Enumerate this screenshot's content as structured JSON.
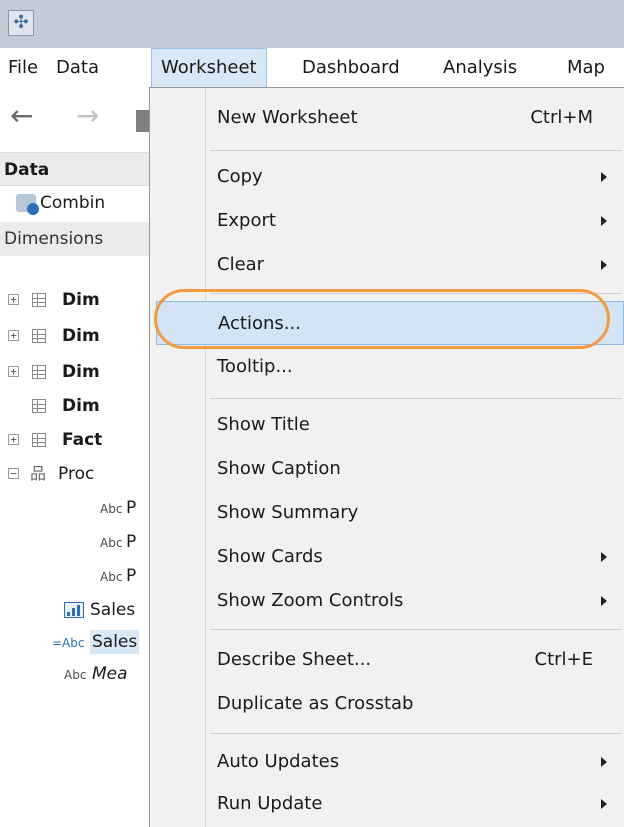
{
  "menubar": {
    "items": [
      "File",
      "Data",
      "Worksheet",
      "Dashboard",
      "Analysis",
      "Map"
    ]
  },
  "sidebar": {
    "data_header": "Data",
    "datasource": "Combin",
    "dimensions_header": "Dimensions",
    "tree": [
      {
        "label": "Dim",
        "type": "table",
        "expandable": true,
        "bold": true
      },
      {
        "label": "Dim",
        "type": "table",
        "expandable": true,
        "bold": true
      },
      {
        "label": "Dim",
        "type": "table",
        "expandable": true,
        "bold": true
      },
      {
        "label": "Dim",
        "type": "table",
        "expandable": false,
        "bold": true
      },
      {
        "label": "Fact",
        "type": "table",
        "expandable": true,
        "bold": true
      },
      {
        "label": "Proc",
        "type": "hierarchy",
        "expandable": true,
        "expanded": true,
        "bold": false
      },
      {
        "label": "P",
        "type": "abc",
        "bold": false
      },
      {
        "label": "P",
        "type": "abc",
        "bold": false
      },
      {
        "label": "P",
        "type": "abc",
        "bold": false
      },
      {
        "label": "Sales",
        "type": "bar",
        "bold": false
      },
      {
        "label": "Sales",
        "type": "calc-abc",
        "bold": false,
        "selected": true
      },
      {
        "label": "Mea",
        "type": "abc",
        "bold": false,
        "italic": true
      }
    ],
    "abc_text": "Abc",
    "calc_abc_text": "=Abc"
  },
  "worksheet_menu": {
    "items": [
      {
        "label": "New Worksheet",
        "shortcut": "Ctrl+M",
        "submenu": false
      },
      {
        "label": "Copy",
        "shortcut": "",
        "submenu": true
      },
      {
        "label": "Export",
        "shortcut": "",
        "submenu": true
      },
      {
        "label": "Clear",
        "shortcut": "",
        "submenu": true
      },
      {
        "label": "Actions...",
        "shortcut": "",
        "submenu": false,
        "highlighted": true
      },
      {
        "label": "Tooltip...",
        "shortcut": "",
        "submenu": false
      },
      {
        "label": "Show Title",
        "shortcut": "",
        "submenu": false
      },
      {
        "label": "Show Caption",
        "shortcut": "",
        "submenu": false
      },
      {
        "label": "Show Summary",
        "shortcut": "",
        "submenu": false
      },
      {
        "label": "Show Cards",
        "shortcut": "",
        "submenu": true
      },
      {
        "label": "Show Zoom Controls",
        "shortcut": "",
        "submenu": true
      },
      {
        "label": "Describe Sheet...",
        "shortcut": "Ctrl+E",
        "submenu": false
      },
      {
        "label": "Duplicate as Crosstab",
        "shortcut": "",
        "submenu": false
      },
      {
        "label": "Auto Updates",
        "shortcut": "",
        "submenu": true
      },
      {
        "label": "Run Update",
        "shortcut": "",
        "submenu": true
      }
    ]
  },
  "colors": {
    "highlight_oval": "#f29a3f",
    "menu_highlight": "#d2e4f6",
    "active_menu": "#d9e8f7"
  }
}
